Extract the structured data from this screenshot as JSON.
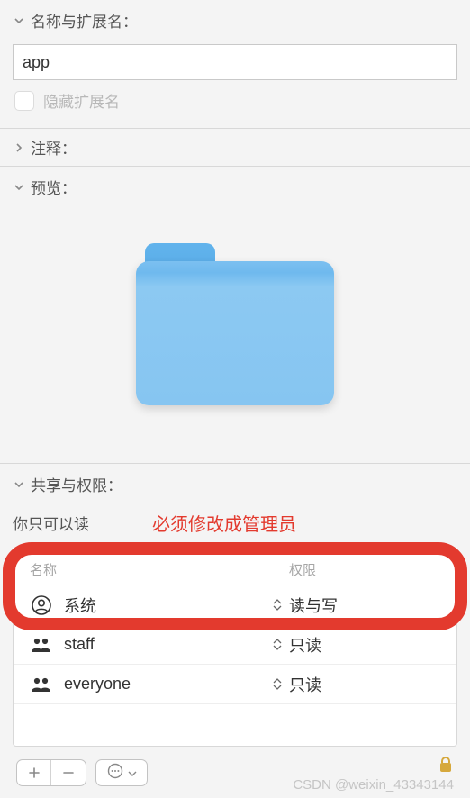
{
  "sections": {
    "name_ext": {
      "title": "名称与扩展名：",
      "value": "app",
      "hide_ext_label": "隐藏扩展名"
    },
    "comments": {
      "title": "注释："
    },
    "preview": {
      "title": "预览："
    },
    "sharing": {
      "title": "共享与权限：",
      "status": "你只可以读",
      "note": "必须修改成管理员",
      "columns": {
        "name": "名称",
        "privilege": "权限"
      },
      "rows": [
        {
          "icon": "user-circle",
          "name": "系统",
          "privilege": "读与写"
        },
        {
          "icon": "users",
          "name": "staff",
          "privilege": "只读"
        },
        {
          "icon": "users",
          "name": "everyone",
          "privilege": "只读"
        }
      ]
    }
  },
  "watermark": "CSDN @weixin_43343144"
}
